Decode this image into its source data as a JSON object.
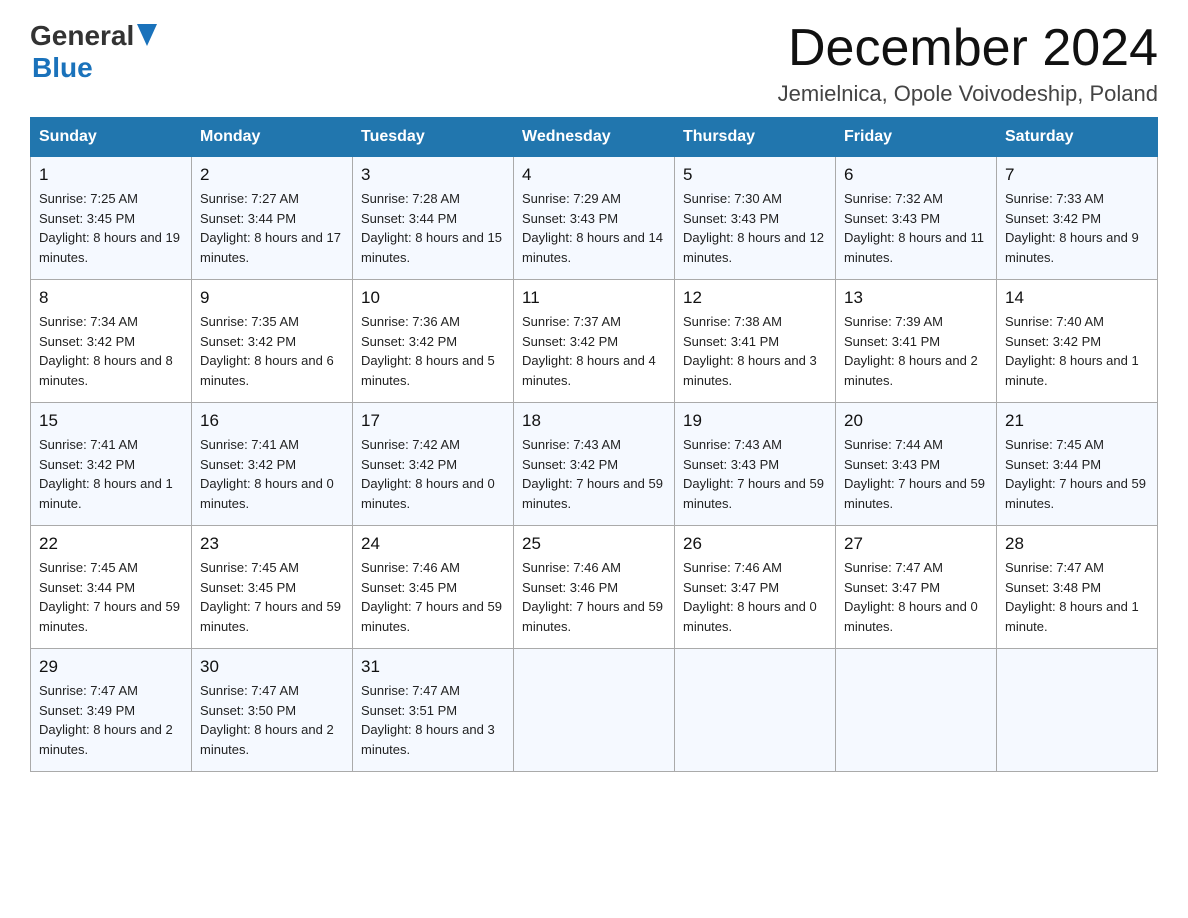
{
  "header": {
    "logo_general": "General",
    "logo_blue": "Blue",
    "month": "December 2024",
    "location": "Jemielnica, Opole Voivodeship, Poland"
  },
  "days_of_week": [
    "Sunday",
    "Monday",
    "Tuesday",
    "Wednesday",
    "Thursday",
    "Friday",
    "Saturday"
  ],
  "weeks": [
    [
      {
        "day": "1",
        "sunrise": "7:25 AM",
        "sunset": "3:45 PM",
        "daylight": "8 hours and 19 minutes."
      },
      {
        "day": "2",
        "sunrise": "7:27 AM",
        "sunset": "3:44 PM",
        "daylight": "8 hours and 17 minutes."
      },
      {
        "day": "3",
        "sunrise": "7:28 AM",
        "sunset": "3:44 PM",
        "daylight": "8 hours and 15 minutes."
      },
      {
        "day": "4",
        "sunrise": "7:29 AM",
        "sunset": "3:43 PM",
        "daylight": "8 hours and 14 minutes."
      },
      {
        "day": "5",
        "sunrise": "7:30 AM",
        "sunset": "3:43 PM",
        "daylight": "8 hours and 12 minutes."
      },
      {
        "day": "6",
        "sunrise": "7:32 AM",
        "sunset": "3:43 PM",
        "daylight": "8 hours and 11 minutes."
      },
      {
        "day": "7",
        "sunrise": "7:33 AM",
        "sunset": "3:42 PM",
        "daylight": "8 hours and 9 minutes."
      }
    ],
    [
      {
        "day": "8",
        "sunrise": "7:34 AM",
        "sunset": "3:42 PM",
        "daylight": "8 hours and 8 minutes."
      },
      {
        "day": "9",
        "sunrise": "7:35 AM",
        "sunset": "3:42 PM",
        "daylight": "8 hours and 6 minutes."
      },
      {
        "day": "10",
        "sunrise": "7:36 AM",
        "sunset": "3:42 PM",
        "daylight": "8 hours and 5 minutes."
      },
      {
        "day": "11",
        "sunrise": "7:37 AM",
        "sunset": "3:42 PM",
        "daylight": "8 hours and 4 minutes."
      },
      {
        "day": "12",
        "sunrise": "7:38 AM",
        "sunset": "3:41 PM",
        "daylight": "8 hours and 3 minutes."
      },
      {
        "day": "13",
        "sunrise": "7:39 AM",
        "sunset": "3:41 PM",
        "daylight": "8 hours and 2 minutes."
      },
      {
        "day": "14",
        "sunrise": "7:40 AM",
        "sunset": "3:42 PM",
        "daylight": "8 hours and 1 minute."
      }
    ],
    [
      {
        "day": "15",
        "sunrise": "7:41 AM",
        "sunset": "3:42 PM",
        "daylight": "8 hours and 1 minute."
      },
      {
        "day": "16",
        "sunrise": "7:41 AM",
        "sunset": "3:42 PM",
        "daylight": "8 hours and 0 minutes."
      },
      {
        "day": "17",
        "sunrise": "7:42 AM",
        "sunset": "3:42 PM",
        "daylight": "8 hours and 0 minutes."
      },
      {
        "day": "18",
        "sunrise": "7:43 AM",
        "sunset": "3:42 PM",
        "daylight": "7 hours and 59 minutes."
      },
      {
        "day": "19",
        "sunrise": "7:43 AM",
        "sunset": "3:43 PM",
        "daylight": "7 hours and 59 minutes."
      },
      {
        "day": "20",
        "sunrise": "7:44 AM",
        "sunset": "3:43 PM",
        "daylight": "7 hours and 59 minutes."
      },
      {
        "day": "21",
        "sunrise": "7:45 AM",
        "sunset": "3:44 PM",
        "daylight": "7 hours and 59 minutes."
      }
    ],
    [
      {
        "day": "22",
        "sunrise": "7:45 AM",
        "sunset": "3:44 PM",
        "daylight": "7 hours and 59 minutes."
      },
      {
        "day": "23",
        "sunrise": "7:45 AM",
        "sunset": "3:45 PM",
        "daylight": "7 hours and 59 minutes."
      },
      {
        "day": "24",
        "sunrise": "7:46 AM",
        "sunset": "3:45 PM",
        "daylight": "7 hours and 59 minutes."
      },
      {
        "day": "25",
        "sunrise": "7:46 AM",
        "sunset": "3:46 PM",
        "daylight": "7 hours and 59 minutes."
      },
      {
        "day": "26",
        "sunrise": "7:46 AM",
        "sunset": "3:47 PM",
        "daylight": "8 hours and 0 minutes."
      },
      {
        "day": "27",
        "sunrise": "7:47 AM",
        "sunset": "3:47 PM",
        "daylight": "8 hours and 0 minutes."
      },
      {
        "day": "28",
        "sunrise": "7:47 AM",
        "sunset": "3:48 PM",
        "daylight": "8 hours and 1 minute."
      }
    ],
    [
      {
        "day": "29",
        "sunrise": "7:47 AM",
        "sunset": "3:49 PM",
        "daylight": "8 hours and 2 minutes."
      },
      {
        "day": "30",
        "sunrise": "7:47 AM",
        "sunset": "3:50 PM",
        "daylight": "8 hours and 2 minutes."
      },
      {
        "day": "31",
        "sunrise": "7:47 AM",
        "sunset": "3:51 PM",
        "daylight": "8 hours and 3 minutes."
      },
      null,
      null,
      null,
      null
    ]
  ],
  "labels": {
    "sunrise": "Sunrise:",
    "sunset": "Sunset:",
    "daylight": "Daylight:"
  }
}
